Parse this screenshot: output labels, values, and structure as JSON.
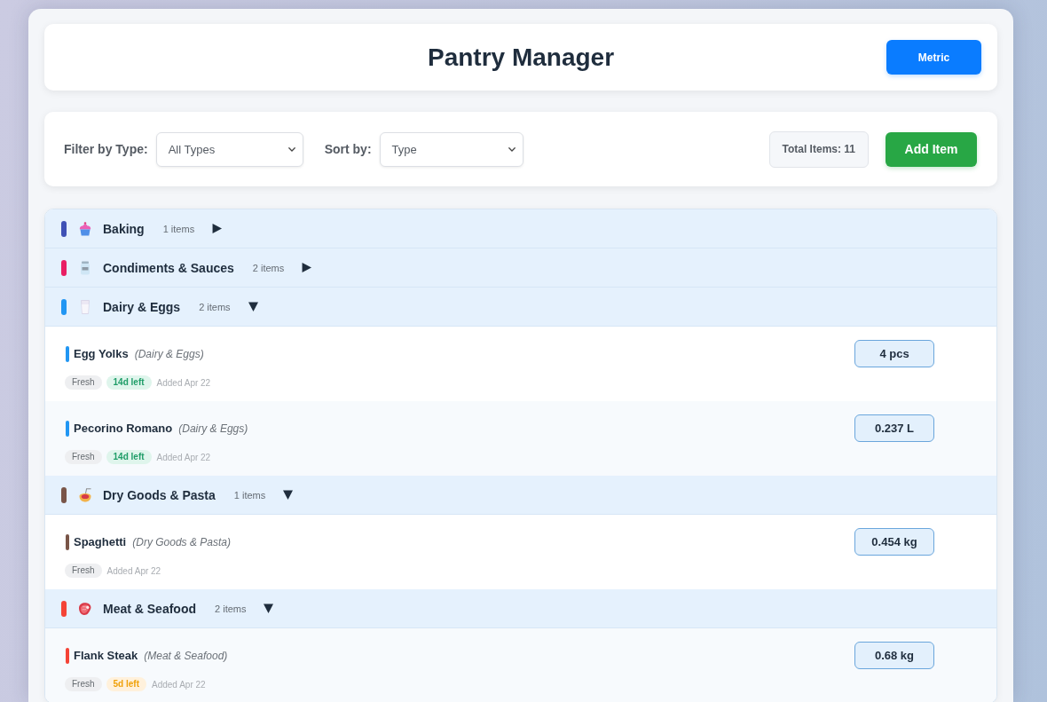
{
  "header": {
    "title": "Pantry Manager",
    "unit_button": "Metric"
  },
  "toolbar": {
    "filter": {
      "label": "Filter by Type:",
      "value": "All Types"
    },
    "sort": {
      "label": "Sort by:",
      "value": "Type"
    },
    "total": "Total Items: 11",
    "add_button": "Add Item"
  },
  "groups": [
    {
      "name": "Baking",
      "count": "1 items",
      "color": "#3f51b5",
      "expanded": false
    },
    {
      "name": "Condiments & Sauces",
      "count": "2 items",
      "color": "#e91e63",
      "expanded": false
    },
    {
      "name": "Dairy & Eggs",
      "count": "2 items",
      "color": "#2196f3",
      "expanded": true,
      "items": [
        {
          "name": "Egg Yolks",
          "category": "(Dairy & Eggs)",
          "quantity": "4 pcs",
          "tags": [
            {
              "kind": "status",
              "text": "Fresh"
            },
            {
              "kind": "ok",
              "text": "14d left"
            }
          ],
          "added": "Added Apr 22"
        },
        {
          "name": "Pecorino Romano",
          "category": "(Dairy & Eggs)",
          "quantity": "0.237 L",
          "tags": [
            {
              "kind": "status",
              "text": "Fresh"
            },
            {
              "kind": "ok",
              "text": "14d left"
            }
          ],
          "added": "Added Apr 22"
        }
      ]
    },
    {
      "name": "Dry Goods & Pasta",
      "count": "1 items",
      "color": "#795548",
      "expanded": true,
      "items": [
        {
          "name": "Spaghetti",
          "category": "(Dry Goods & Pasta)",
          "quantity": "0.454 kg",
          "tags": [
            {
              "kind": "status",
              "text": "Fresh"
            }
          ],
          "added": "Added Apr 22"
        }
      ]
    },
    {
      "name": "Meat & Seafood",
      "count": "2 items",
      "color": "#f44336",
      "expanded": true,
      "items": [
        {
          "name": "Flank Steak",
          "category": "(Meat & Seafood)",
          "quantity": "0.68 kg",
          "tags": [
            {
              "kind": "status",
              "text": "Fresh"
            },
            {
              "kind": "soon",
              "text": "5d left"
            }
          ],
          "added": "Added Apr 22"
        }
      ]
    }
  ]
}
